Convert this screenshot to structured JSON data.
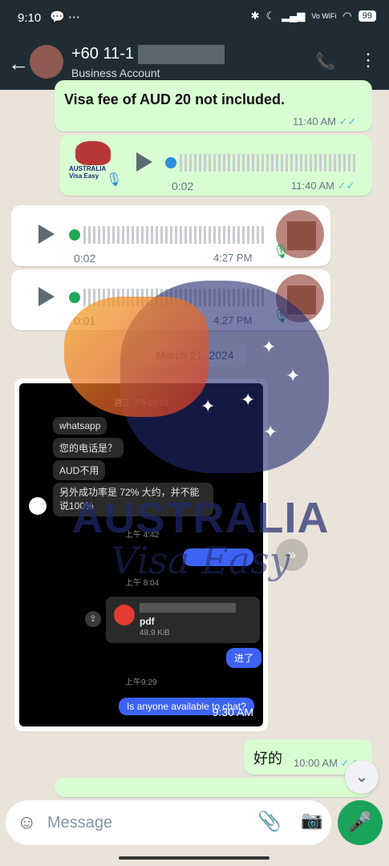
{
  "status": {
    "time": "9:10",
    "notif_icons": "💬 ⋯",
    "battery": "99",
    "signal_text": "Vo WiFi"
  },
  "header": {
    "name": "+60 11-1",
    "subtitle": "Business Account"
  },
  "messages": {
    "text1": {
      "text": "Visa fee of AUD 20 not included.",
      "time": "11:40 AM"
    },
    "voice1": {
      "duration": "0:02",
      "time": "11:40 AM",
      "logo_text": "AUSTRALIA Visa Easy"
    },
    "voice2": {
      "duration": "0:02",
      "time": "4:27 PM"
    },
    "voice3": {
      "duration": "0:01",
      "time": "4:27 PM"
    },
    "date_chip": "March 21, 2024",
    "image": {
      "time": "9:30 AM",
      "top_time": "週三 下午10:59",
      "bubbles": [
        "whatsapp",
        "您的电话是？",
        "AUD不用",
        "另外成功率是 72% 大约，并不能说100%"
      ],
      "time_1": "上午 4:42",
      "time_2": "上午 8:04",
      "file_name": "pdf",
      "file_size": "48.9 KiB",
      "reply_1": "进了",
      "time_3": "上午9:29",
      "reply_2": "Is anyone available to chat?"
    },
    "text2": {
      "text": "好的",
      "time": "10:00 AM"
    }
  },
  "watermark": {
    "title": "AUSTRALIA",
    "subtitle": "Visa Easy"
  },
  "input": {
    "placeholder": "Message"
  },
  "colors": {
    "header_bg": "#1f2c34",
    "outgoing": "#d9fdd3",
    "incoming": "#ffffff",
    "accent_green": "#1aa35a",
    "tick_blue": "#53bdeb"
  }
}
